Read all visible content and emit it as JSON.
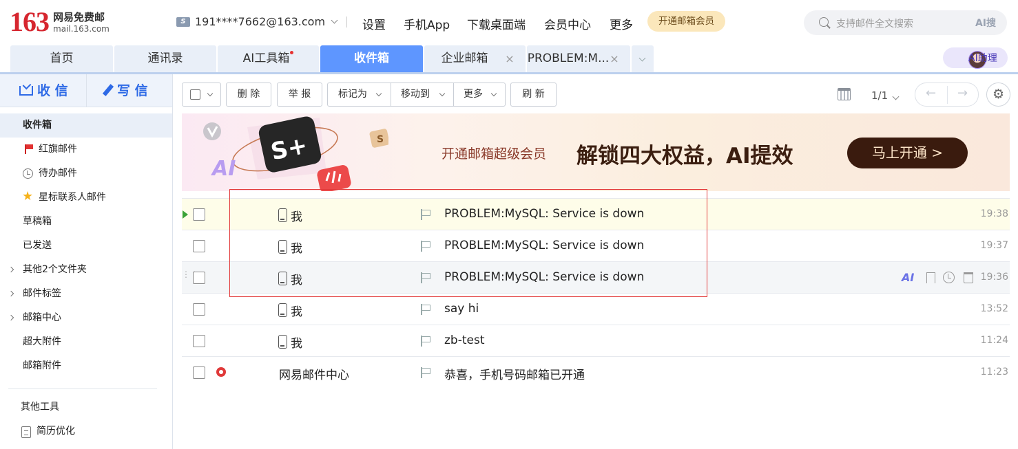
{
  "header": {
    "logo_num": "163",
    "logo_cn": "网易免费邮",
    "logo_en": "mail.163.com",
    "account_icon": "S",
    "account": "191****7662@163.com",
    "nav": [
      "设置",
      "手机App",
      "下载桌面端",
      "会员中心",
      "更多"
    ],
    "vip_label": "开通邮箱会员",
    "search_placeholder": "支持邮件全文搜索",
    "ai_search": "AI搜"
  },
  "tabs": [
    {
      "label": "首页"
    },
    {
      "label": "通讯录"
    },
    {
      "label": "AI工具箱"
    },
    {
      "label": "收件箱"
    },
    {
      "label": "企业邮箱"
    },
    {
      "label": "PROBLEM:M..."
    }
  ],
  "tab_close": "×",
  "ai_assistant": "AI助理",
  "sidebar": {
    "receive": "收 信",
    "write": "写 信",
    "items": [
      {
        "label": "收件箱"
      },
      {
        "label": "红旗邮件"
      },
      {
        "label": "待办邮件"
      },
      {
        "label": "星标联系人邮件"
      },
      {
        "label": "草稿箱"
      },
      {
        "label": "已发送"
      },
      {
        "label": "其他2个文件夹"
      },
      {
        "label": "邮件标签"
      },
      {
        "label": "邮箱中心"
      },
      {
        "label": "超大附件"
      },
      {
        "label": "邮箱附件"
      }
    ],
    "tools_title": "其他工具",
    "resume": "简历优化"
  },
  "toolbar": {
    "delete": "删 除",
    "report": "举 报",
    "mark_as": "标记为",
    "move_to": "移动到",
    "more": "更多",
    "refresh": "刷 新",
    "page": "1/1",
    "prev": "←",
    "next": "→",
    "settings_glyph": "⚙"
  },
  "banner": {
    "subtitle": "开通邮箱超级会员",
    "headline": "解锁四大权益，AI提效",
    "cta": "马上开通 >",
    "badge": "S+",
    "art_ai": "AI",
    "art_s": "S"
  },
  "mail_ai_label": "AI",
  "messages": [
    {
      "from": "我",
      "subject": "PROBLEM:MySQL: Service is down",
      "time": "19:38"
    },
    {
      "from": "我",
      "subject": "PROBLEM:MySQL: Service is down",
      "time": "19:37"
    },
    {
      "from": "我",
      "subject": "PROBLEM:MySQL: Service is down",
      "time": "19:36"
    },
    {
      "from": "我",
      "subject": "say hi",
      "time": "13:52"
    },
    {
      "from": "我",
      "subject": "zb-test",
      "time": "11:24"
    },
    {
      "from": "网易邮件中心",
      "subject": "恭喜，手机号码邮箱已开通",
      "time": "11:23"
    }
  ],
  "colors": {
    "accent": "#5e96ff",
    "brand_red": "#d6262f",
    "highlight": "#e23a3a"
  }
}
